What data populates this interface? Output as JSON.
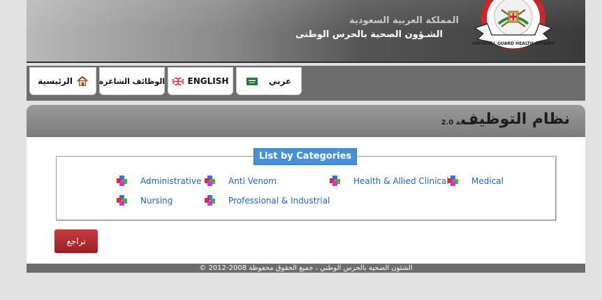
{
  "header": {
    "kingdom_text": "المملكة العربية السعودية",
    "affairs_text": "الشـؤون الصحية بالحرس الوطنى",
    "logo_text": "NATIONAL GUARD HEALTH AFFAIRS"
  },
  "nav": {
    "home": "الرئيسية",
    "jobs": "الوظائف الشاغرة",
    "english": "ENGLISH",
    "arabic": "عربي"
  },
  "page": {
    "title": "نظام التوظيف",
    "version": "نسخة 2.0"
  },
  "categories": {
    "heading": "List by Categories",
    "items": [
      {
        "label": "Administrative"
      },
      {
        "label": "Anti Venom"
      },
      {
        "label": "Health & Allied Clinical"
      },
      {
        "label": "Medical"
      },
      {
        "label": "Nursing"
      },
      {
        "label": "Professional & Industrial"
      }
    ]
  },
  "actions": {
    "back": "تراجع"
  },
  "footer": {
    "copyright": "الشئون الصحية بالحرس الوطني ، جميع الحقوق محفوظة 2008-2012 ©"
  },
  "colors": {
    "accent_blue": "#4a8fd6",
    "link_blue": "#2465b3",
    "button_red": "#b02a30",
    "bar_gray": "#6d6d6d"
  },
  "icons": [
    "home-icon",
    "uk-flag-icon",
    "saudi-flag-icon",
    "category-icon"
  ]
}
